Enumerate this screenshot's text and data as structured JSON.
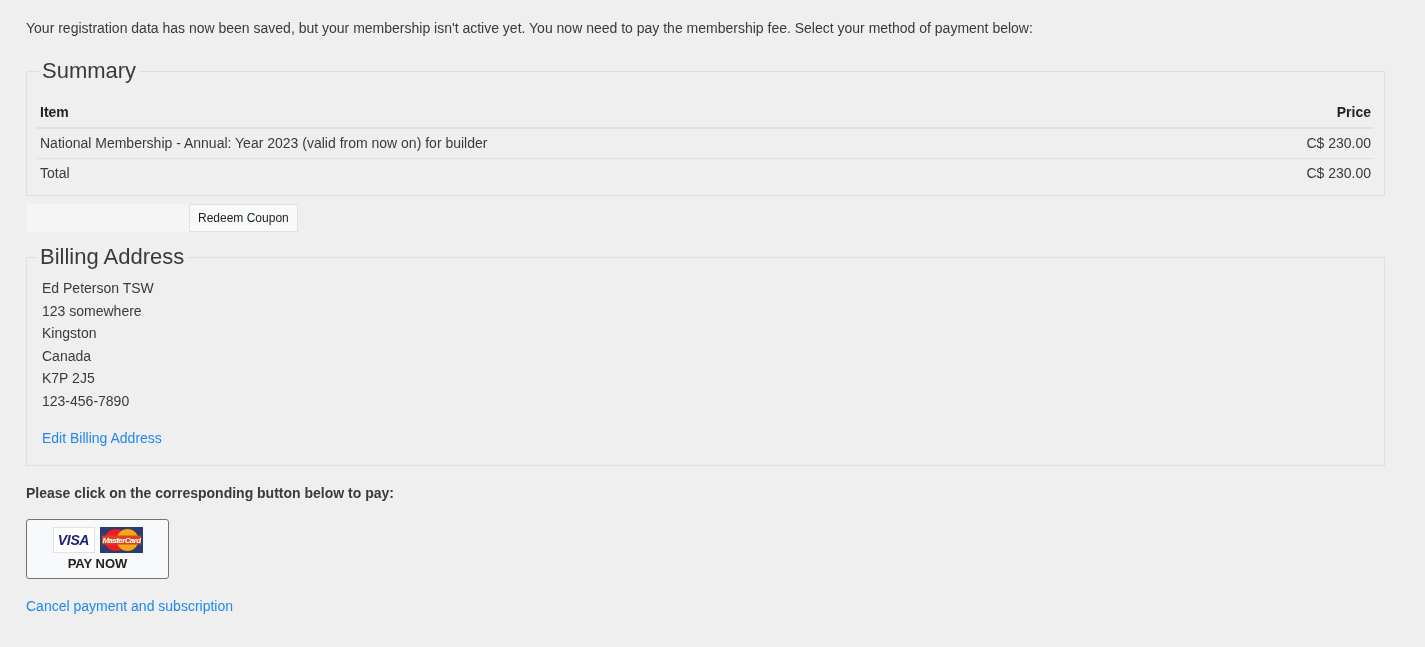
{
  "intro": "Your registration data has now been saved, but your membership isn't active yet. You now need to pay the membership fee. Select your method of payment below:",
  "summary": {
    "legend": "Summary",
    "columns": [
      "Item",
      "Price"
    ],
    "rows": [
      [
        "National Membership - Annual: Year 2023 (valid from now on) for builder",
        "C$ 230.00"
      ],
      [
        "Total",
        "C$ 230.00"
      ]
    ]
  },
  "coupon": {
    "button": "Redeem Coupon"
  },
  "billing": {
    "legend": "Billing Address",
    "lines": [
      "Ed Peterson TSW",
      "123 somewhere",
      "Kingston",
      "Canada",
      "K7P 2J5",
      "123-456-7890"
    ],
    "edit_link": "Edit Billing Address"
  },
  "pay_prompt": "Please click on the corresponding button below to pay:",
  "pay_button": {
    "logos": [
      {
        "kind": "visa",
        "text": "VISA"
      },
      {
        "kind": "mastercard",
        "text": "MasterCard"
      }
    ],
    "label": "PAY NOW"
  },
  "cancel_link": "Cancel payment and subscription"
}
